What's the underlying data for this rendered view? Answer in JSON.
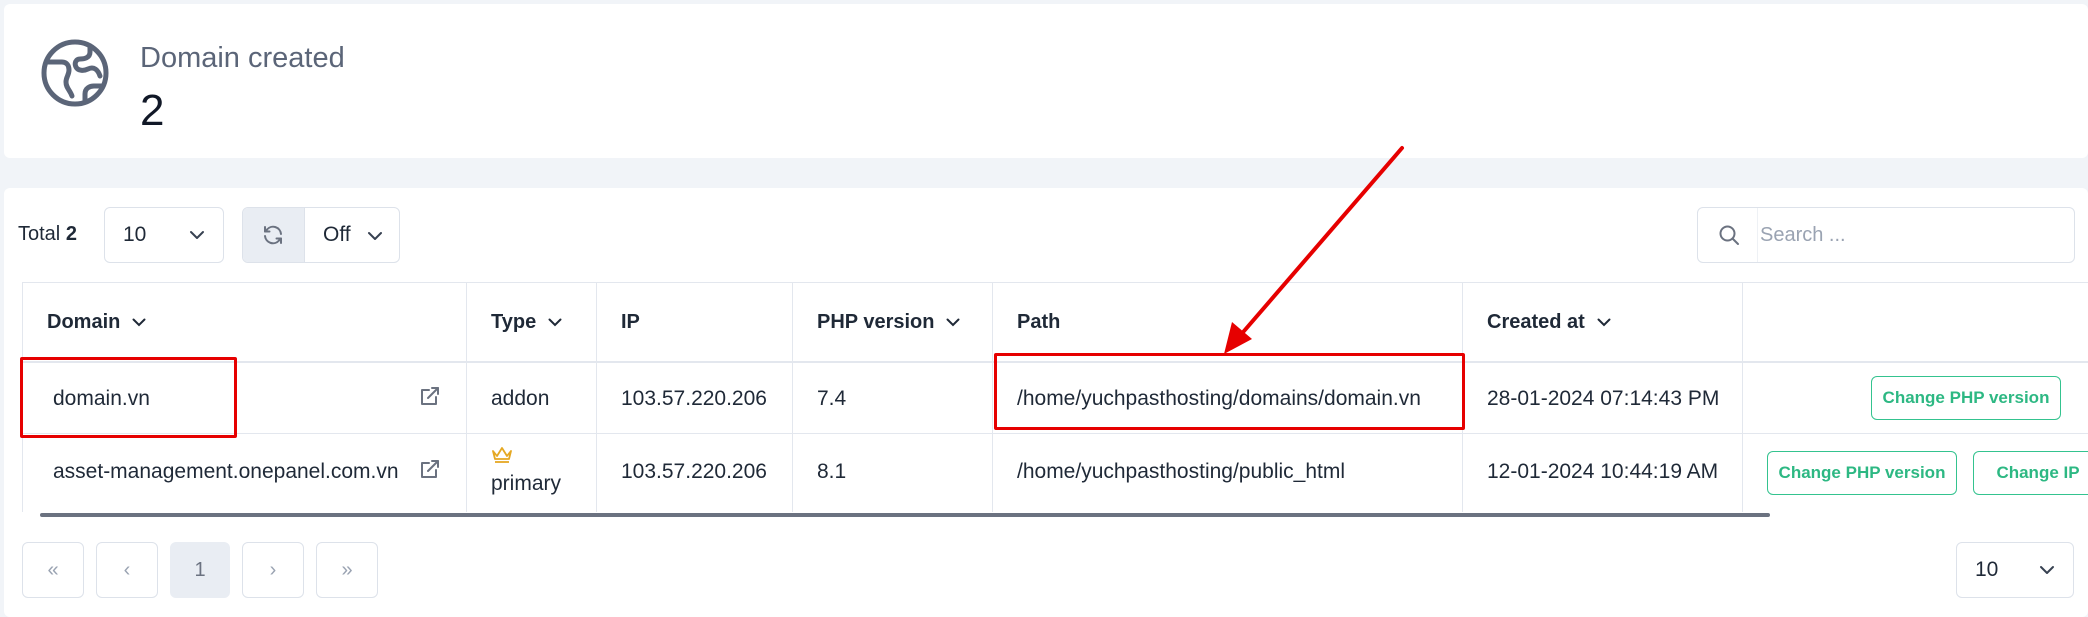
{
  "stats": {
    "icon": "globe-icon",
    "label": "Domain created",
    "value": "2"
  },
  "toolbar": {
    "total_label": "Total",
    "total_value": "2",
    "page_size": "10",
    "refresh_icon": "refresh-icon",
    "auto_refresh": "Off",
    "search_placeholder": "Search ..."
  },
  "table": {
    "headers": {
      "domain": "Domain",
      "type": "Type",
      "ip": "IP",
      "php": "PHP version",
      "path": "Path",
      "created": "Created at"
    },
    "rows": [
      {
        "domain": "domain.vn",
        "type": "addon",
        "ip": "103.57.220.206",
        "php": "7.4",
        "path": "/home/yuchpasthosting/domains/domain.vn",
        "created": "28-01-2024 07:14:43 PM",
        "actions": [
          "Change PHP version"
        ]
      },
      {
        "domain": "asset-management.onepanel.com.vn",
        "type": "primary",
        "type_icon": "crown-icon",
        "ip": "103.57.220.206",
        "php": "8.1",
        "path": "/home/yuchpasthosting/public_html",
        "created": "12-01-2024 10:44:19 AM",
        "actions": [
          "Change PHP version",
          "Change IP"
        ]
      }
    ]
  },
  "pagination": {
    "first": "«",
    "prev": "‹",
    "current": "1",
    "next": "›",
    "last": "»",
    "page_size": "10"
  },
  "colors": {
    "accent_green": "#34c38f",
    "annotation_red": "#e60000",
    "crown": "#e5a823"
  }
}
